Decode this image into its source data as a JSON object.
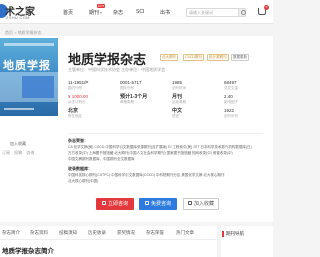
{
  "site": {
    "logo_text": "术之家",
    "logo_sub": "ZSHU.COM"
  },
  "nav": {
    "items": [
      {
        "label": "首页",
        "caret": ""
      },
      {
        "label": "期刊",
        "caret": "▾",
        "badge": "HOT"
      },
      {
        "label": "杂志",
        "caret": ""
      },
      {
        "label": "SCI",
        "caret": ""
      },
      {
        "label": "出书",
        "caret": ""
      }
    ],
    "search_placeholder": "请输入关键词",
    "cart_count": "0"
  },
  "breadcrumb": "首页 > 地质学报杂志",
  "journal": {
    "title": "地质学报杂志",
    "tags": [
      "北大期刊",
      "CSCD期刊",
      "统计源期刊"
    ],
    "tag_right": "数据更新",
    "subline": "主管单位：中国科学技术协会   主办单位：中国地质学会",
    "cover_title": "地质学报",
    "cover_caption": "加入收藏",
    "thumb_links": [
      "订阅",
      "投稿",
      "咨询"
    ]
  },
  "stats": [
    {
      "value": "11-1951/P",
      "label": "国内刊号"
    },
    {
      "value": "0001-5717",
      "label": "国际刊号"
    },
    {
      "value": "1985",
      "label": "创刊时间"
    },
    {
      "value": "68497",
      "label": "总发文量"
    },
    {
      "value": "¥ 1000.00",
      "label": "杂志订购价",
      "red": true
    },
    {
      "value": "预计1-3个月",
      "label": "审稿周期"
    },
    {
      "value": "月刊",
      "label": "出版周期"
    },
    {
      "value": "2.40",
      "label": "影响因子"
    },
    {
      "value": "北京",
      "label": "所在地区"
    },
    {
      "value": "中文",
      "label": "语言"
    },
    {
      "value": "1922",
      "label": "创刊年份"
    }
  ],
  "sections": {
    "honors_title": "杂志荣誉：",
    "honors": [
      "CA 化学文摘(美)  CSCD 中国科学引文数据库来源期刊(含扩展版)  EI 工程索引(美)  JST 日本科学技术振兴机构数据库(日)",
      "万方收录(中)  上海图书馆馆藏  北大期刊(中国人文社会科学期刊)  国家图书馆馆藏  知网收录(中)  维普收录(中)",
      "中国文摘期刊数据库、中国期刊全文数据库"
    ],
    "database_title": "收录数据库：",
    "database": [
      "中国科技核心期刊(CSTPC)  中国科学引文数据库(CSCD)  中科院期刊分区  美国化学文摘  北大核心期刊",
      "北大核心期刊(中国)"
    ]
  },
  "buttons": {
    "submit": "立即咨询",
    "subscribe": "免费咨询",
    "collect": "加入收藏"
  },
  "tabs": [
    "杂志简介",
    "杂志资料",
    "投稿须知",
    "历史收录",
    "获奖情况",
    "杂志荣誉",
    "热门文章"
  ],
  "side_title": "期刊导航",
  "intro_title": "地质学报杂志简介"
}
